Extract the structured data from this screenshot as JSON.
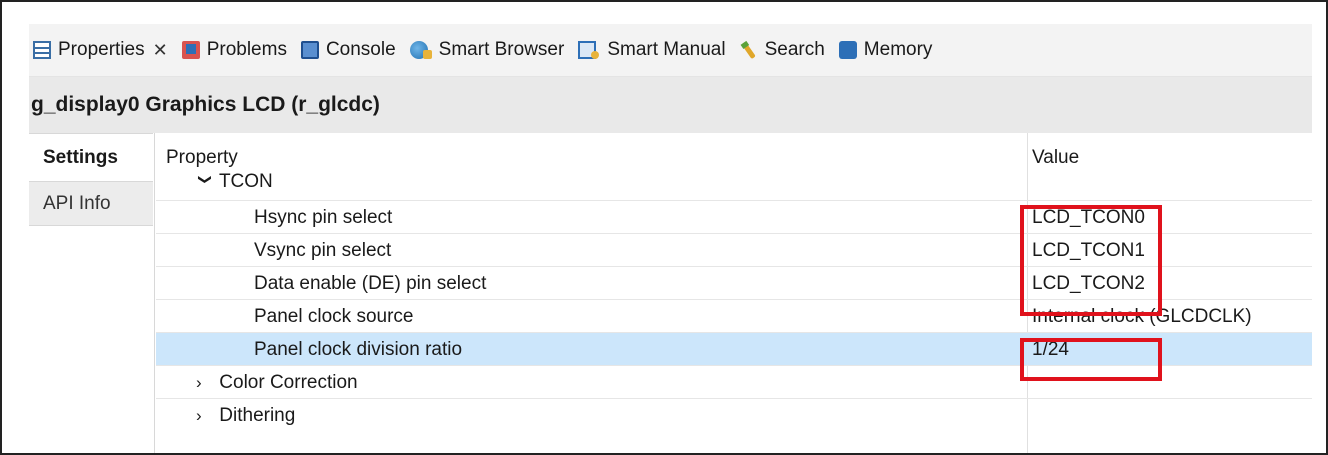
{
  "tabs": [
    {
      "label": "Properties",
      "icon": "properties-icon",
      "active": true,
      "close": "✕"
    },
    {
      "label": "Problems",
      "icon": "problems-icon"
    },
    {
      "label": "Console",
      "icon": "console-icon"
    },
    {
      "label": "Smart Browser",
      "icon": "smart-browser-icon"
    },
    {
      "label": "Smart Manual",
      "icon": "smart-manual-icon"
    },
    {
      "label": "Search",
      "icon": "search-icon"
    },
    {
      "label": "Memory",
      "icon": "memory-icon"
    }
  ],
  "title": "g_display0 Graphics LCD (r_glcdc)",
  "side_tabs": [
    {
      "label": "Settings",
      "selected": true
    },
    {
      "label": "API Info",
      "selected": false
    }
  ],
  "table": {
    "headers": {
      "property": "Property",
      "value": "Value"
    },
    "rows": [
      {
        "name": "TCON",
        "value": "",
        "chevron": "❯",
        "expanded": true
      },
      {
        "name": "Hsync pin select",
        "value": "LCD_TCON0"
      },
      {
        "name": "Vsync pin select",
        "value": "LCD_TCON1"
      },
      {
        "name": "Data enable (DE) pin select",
        "value": "LCD_TCON2"
      },
      {
        "name": "Panel clock source",
        "value": "Internal clock (GLCDCLK)"
      },
      {
        "name": "Panel clock division ratio",
        "value": "1/24",
        "selected": true
      },
      {
        "name": "Color Correction",
        "value": "",
        "chevron": "›",
        "expanded": false
      },
      {
        "name": "Dithering",
        "value": "",
        "chevron": "›",
        "expanded": false
      }
    ]
  },
  "colors": {
    "highlight": "#e0121c",
    "selected_row": "#cce6fb"
  }
}
